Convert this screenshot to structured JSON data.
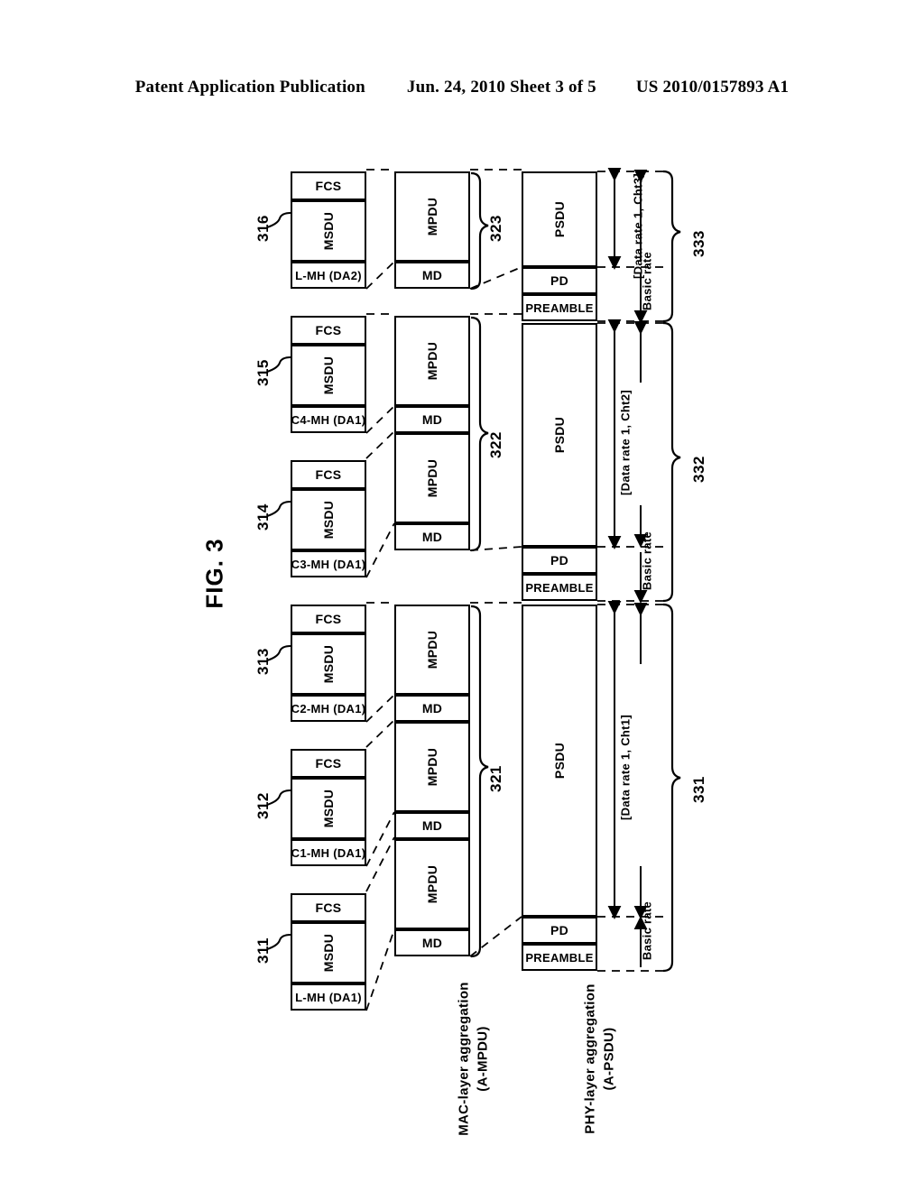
{
  "header": {
    "left": "Patent Application Publication",
    "center": "Jun. 24, 2010  Sheet 3 of 5",
    "right": "US 2010/0157893 A1"
  },
  "figure": {
    "label": "FIG. 3"
  },
  "column_captions": {
    "mac": "MAC-layer aggregation",
    "mac_sub": "(A-MPDU)",
    "phy": "PHY-layer aggregation",
    "phy_sub": "(A-PSDU)"
  },
  "msdu_blocks": [
    {
      "ref": "316",
      "fcs": "FCS",
      "msdu": "MSDU",
      "header": "L-MH (DA2)"
    },
    {
      "ref": "315",
      "fcs": "FCS",
      "msdu": "MSDU",
      "header": "C4-MH (DA1)"
    },
    {
      "ref": "314",
      "fcs": "FCS",
      "msdu": "MSDU",
      "header": "C3-MH (DA1)"
    },
    {
      "ref": "313",
      "fcs": "FCS",
      "msdu": "MSDU",
      "header": "C2-MH (DA1)"
    },
    {
      "ref": "312",
      "fcs": "FCS",
      "msdu": "MSDU",
      "header": "C1-MH (DA1)"
    },
    {
      "ref": "311",
      "fcs": "FCS",
      "msdu": "MSDU",
      "header": "L-MH (DA1)"
    }
  ],
  "ampdu_groups": [
    {
      "ref": "323",
      "units": [
        {
          "mpdu": "MPDU",
          "md": "MD"
        }
      ]
    },
    {
      "ref": "322",
      "units": [
        {
          "mpdu": "MPDU",
          "md": "MD"
        },
        {
          "mpdu": "MPDU",
          "md": "MD"
        }
      ]
    },
    {
      "ref": "321",
      "units": [
        {
          "mpdu": "MPDU",
          "md": "MD"
        },
        {
          "mpdu": "MPDU",
          "md": "MD"
        },
        {
          "mpdu": "MPDU",
          "md": "MD"
        }
      ]
    }
  ],
  "apsdu_groups": [
    {
      "ref": "333",
      "psdu": "PSDU",
      "pd": "PD",
      "preamble": "PREAMBLE",
      "rate_label": "[Data rate 1, Cht3]",
      "basic_rate": "Basic rate"
    },
    {
      "ref": "332",
      "psdu": "PSDU",
      "pd": "PD",
      "preamble": "PREAMBLE",
      "rate_label": "[Data rate 1, Cht2]",
      "basic_rate": "Basic rate"
    },
    {
      "ref": "331",
      "psdu": "PSDU",
      "pd": "PD",
      "preamble": "PREAMBLE",
      "rate_label": "[Data rate 1, Cht1]",
      "basic_rate": "Basic rate"
    }
  ]
}
